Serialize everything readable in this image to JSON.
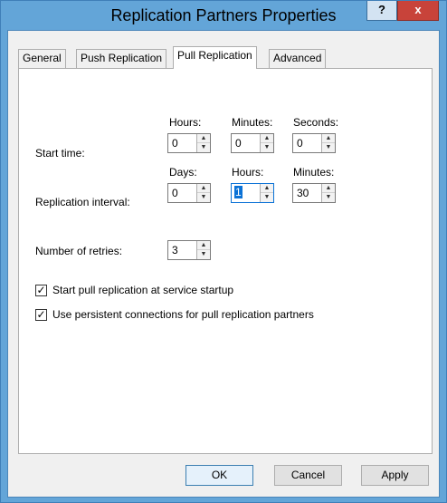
{
  "window": {
    "title": "Replication Partners Properties",
    "help_label": "?",
    "close_label": "x"
  },
  "tabs": [
    {
      "label": "General"
    },
    {
      "label": "Push Replication"
    },
    {
      "label": "Pull Replication",
      "active": true
    },
    {
      "label": "Advanced"
    }
  ],
  "start_time": {
    "label": "Start time:",
    "hours_label": "Hours:",
    "hours_value": "0",
    "minutes_label": "Minutes:",
    "minutes_value": "0",
    "seconds_label": "Seconds:",
    "seconds_value": "0"
  },
  "replication_interval": {
    "label": "Replication interval:",
    "days_label": "Days:",
    "days_value": "0",
    "hours_label": "Hours:",
    "hours_value": "1",
    "minutes_label": "Minutes:",
    "minutes_value": "30"
  },
  "retries": {
    "label": "Number of retries:",
    "value": "3"
  },
  "options": {
    "startup_label": "Start pull replication at service startup",
    "startup_checked": true,
    "persistent_label": "Use persistent connections for pull replication partners",
    "persistent_checked": true
  },
  "buttons": {
    "ok": "OK",
    "cancel": "Cancel",
    "apply": "Apply"
  },
  "colors": {
    "titlebar": "#63a5d8",
    "close": "#c8433a",
    "selection": "#0b72d6"
  }
}
